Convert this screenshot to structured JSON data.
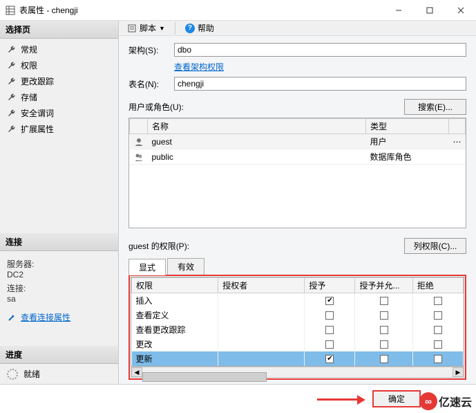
{
  "window": {
    "title": "表属性 - chengji"
  },
  "sidebar": {
    "select_header": "选择页",
    "items": [
      "常规",
      "权限",
      "更改跟踪",
      "存储",
      "安全谓词",
      "扩展属性"
    ],
    "connect_header": "连接",
    "server_label": "服务器:",
    "server_value": "DC2",
    "conn_label": "连接:",
    "conn_value": "sa",
    "view_conn_props": "查看连接属性",
    "progress_header": "进度",
    "status": "就绪"
  },
  "toolbar": {
    "script": "脚本",
    "help": "帮助"
  },
  "form": {
    "schema_label": "架构(S):",
    "schema_value": "dbo",
    "view_schema_perms": "查看架构权限",
    "table_label": "表名(N):",
    "table_value": "chengji",
    "users_label": "用户或角色(U):",
    "search_btn": "搜索(E)..."
  },
  "principals": {
    "cols": {
      "name": "名称",
      "type": "类型"
    },
    "rows": [
      {
        "name": "guest",
        "type": "用户",
        "selected": true
      },
      {
        "name": "public",
        "type": "数据库角色",
        "selected": false
      }
    ]
  },
  "perms": {
    "label": "guest 的权限(P):",
    "col_perm_btn": "列权限(C)...",
    "tabs": {
      "explicit": "显式",
      "effective": "有效"
    },
    "cols": {
      "perm": "权限",
      "grantor": "授权者",
      "grant": "授予",
      "withgrant": "授予并允...",
      "deny": "拒绝"
    },
    "rows": [
      {
        "perm": "插入",
        "grantor": "",
        "grant": true,
        "withgrant": false,
        "deny": false,
        "sel": false
      },
      {
        "perm": "查看定义",
        "grantor": "",
        "grant": false,
        "withgrant": false,
        "deny": false,
        "sel": false
      },
      {
        "perm": "查看更改跟踪",
        "grantor": "",
        "grant": false,
        "withgrant": false,
        "deny": false,
        "sel": false
      },
      {
        "perm": "更改",
        "grantor": "",
        "grant": false,
        "withgrant": false,
        "deny": false,
        "sel": false
      },
      {
        "perm": "更新",
        "grantor": "",
        "grant": true,
        "withgrant": false,
        "deny": false,
        "sel": true
      }
    ]
  },
  "footer": {
    "ok": "确定"
  },
  "watermark": "亿速云"
}
